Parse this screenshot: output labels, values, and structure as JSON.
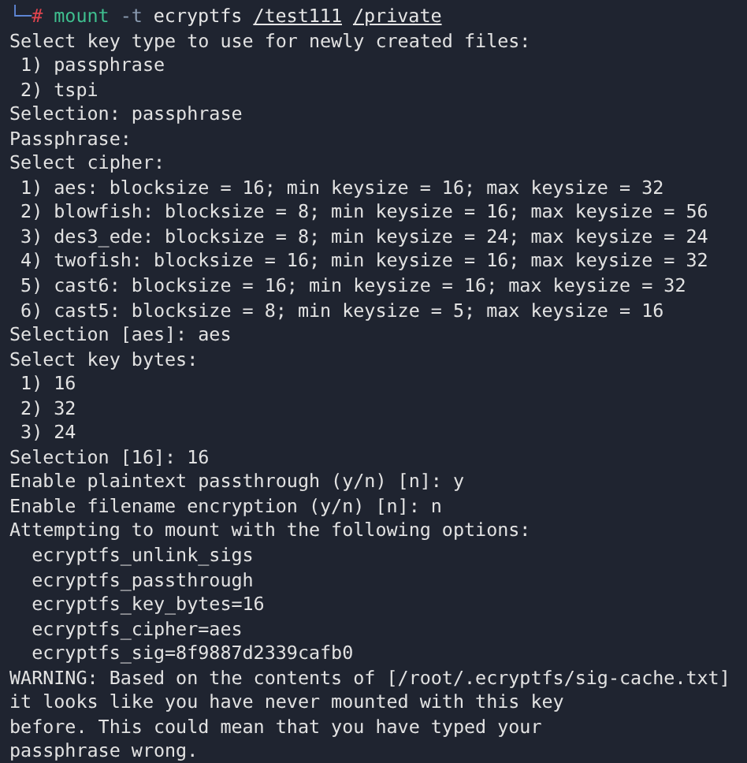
{
  "prompt": {
    "corner": "└─",
    "symbol": "#",
    "command": "mount",
    "args": [
      {
        "text": "-t",
        "kind": "flag"
      },
      {
        "text": "ecryptfs",
        "kind": "plain"
      },
      {
        "text": "/test111",
        "kind": "path"
      },
      {
        "text": "/private",
        "kind": "path"
      }
    ]
  },
  "output": [
    "Select key type to use for newly created files:",
    " 1) passphrase",
    " 2) tspi",
    "Selection: passphrase",
    "Passphrase:",
    "Select cipher:",
    " 1) aes: blocksize = 16; min keysize = 16; max keysize = 32",
    " 2) blowfish: blocksize = 8; min keysize = 16; max keysize = 56",
    " 3) des3_ede: blocksize = 8; min keysize = 24; max keysize = 24",
    " 4) twofish: blocksize = 16; min keysize = 16; max keysize = 32",
    " 5) cast6: blocksize = 16; min keysize = 16; max keysize = 32",
    " 6) cast5: blocksize = 8; min keysize = 5; max keysize = 16",
    "Selection [aes]: aes",
    "Select key bytes:",
    " 1) 16",
    " 2) 32",
    " 3) 24",
    "Selection [16]: 16",
    "Enable plaintext passthrough (y/n) [n]: y",
    "Enable filename encryption (y/n) [n]: n",
    "Attempting to mount with the following options:",
    "  ecryptfs_unlink_sigs",
    "  ecryptfs_passthrough",
    "  ecryptfs_key_bytes=16",
    "  ecryptfs_cipher=aes",
    "  ecryptfs_sig=8f9887d2339cafb0",
    "WARNING: Based on the contents of [/root/.ecryptfs/sig-cache.txt]",
    "it looks like you have never mounted with this key",
    "before. This could mean that you have typed your",
    "passphrase wrong."
  ]
}
